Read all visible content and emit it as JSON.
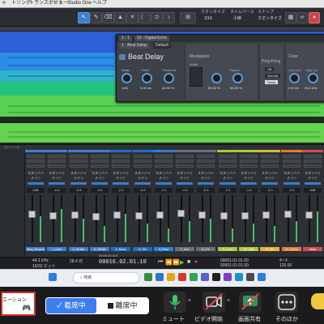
{
  "menubar": {
    "items": [
      "ャ",
      "ト",
      "ソング",
      "トランスポート",
      "ビュー",
      "Studio One",
      "ヘルプ"
    ]
  },
  "toolbar": {
    "tools": [
      "arrow",
      "pencil",
      "eraser",
      "paint",
      "mute",
      "split",
      "glue",
      "listen"
    ],
    "snap": "小節",
    "quantize": "1/16",
    "timebase": "タイムベース",
    "snap_label": "スナップ",
    "quantize_label": "クオンタイズ",
    "snap_value": "クオンタイズ"
  },
  "plugin": {
    "tabs": [
      "1 - 1",
      "12 - Digital Echo",
      "1 - Beat Delay"
    ],
    "title": "Beat Delay",
    "preset": "Default",
    "knobs": [
      {
        "label": "Beats",
        "value": "1/16"
      },
      {
        "label": "Offset",
        "value": "0.00 ms"
      },
      {
        "label": "Feedback",
        "value": "40.00 %"
      }
    ],
    "modulation": {
      "title": "Modulation",
      "items": [
        {
          "label": "Width",
          "value": "50.00 %"
        },
        {
          "label": "Speed",
          "value": "50.00 %"
        },
        {
          "label": "Stereo Spread",
          "value": "dB"
        }
      ]
    },
    "ping_pong": {
      "title": "Ping-Pong",
      "options": [
        "Off",
        "Normal",
        "Swap"
      ]
    },
    "color": {
      "title": "Color",
      "items": [
        {
          "label": "Low Cut",
          "value": "0.00 Hz"
        },
        {
          "label": "High Cut",
          "value": "20.0 kHz"
        }
      ]
    },
    "mix_label": "Mix"
  },
  "console": {
    "label": "コンソール",
    "channels": [
      {
        "name": "Bus_Drums",
        "stripe": "#3b7fd1",
        "volume": "0dB",
        "send": "スタンバイ",
        "mode": "メイン",
        "level": 0.55,
        "fader": 0.62
      },
      {
        "name": "1_Kick",
        "stripe": "#3b7fd1",
        "volume": "-0.6",
        "send": "スタンバイ",
        "mode": "メイン",
        "level": 0.7,
        "fader": 0.58
      },
      {
        "name": "2_Snare",
        "stripe": "#3b7fd1",
        "volume": "-0.5",
        "send": "スタンバイ",
        "mode": "メイン",
        "level": 0.5,
        "fader": 0.6
      },
      {
        "name": "3_HiHat",
        "stripe": "#3b7fd1",
        "volume": "-5.0",
        "send": "スタンバイ",
        "mode": "メイン",
        "level": 0.35,
        "fader": 0.56
      },
      {
        "name": "4_Bass",
        "stripe": "#1e6fc4",
        "volume": "-2.0",
        "send": "スタンバイ",
        "mode": "メイン",
        "level": 0.6,
        "fader": 0.6
      },
      {
        "name": "5_Gtr",
        "stripe": "#1e6fc4",
        "volume": "-3.0",
        "send": "スタンバイ",
        "mode": "メイン",
        "level": 0.4,
        "fader": 0.57
      },
      {
        "name": "6_Pad",
        "stripe": "#2a7fd8",
        "volume": "-1.2",
        "send": "スタンバイ",
        "mode": "メイン",
        "level": 0.3,
        "fader": 0.6
      },
      {
        "name": "7_Vox",
        "stripe": "#6a7079",
        "volume": "-4.5",
        "send": "スタンバイ",
        "mode": "メイン",
        "level": 0.45,
        "fader": 0.63
      },
      {
        "name": "8_FX",
        "stripe": "#6a7079",
        "volume": "-0.5",
        "send": "スタンバイ",
        "mode": "メイン",
        "level": 0.5,
        "fader": 0.6
      },
      {
        "name": "9_Lead",
        "stripe": "#a6c93a",
        "volume": "-2.1",
        "send": "スタンバイ",
        "mode": "メイン",
        "level": 0.3,
        "fader": 0.58
      },
      {
        "name": "10_Arp",
        "stripe": "#b6c93a",
        "volume": "-1.8",
        "send": "スタンバイ",
        "mode": "メイン",
        "level": 0.4,
        "fader": 0.57
      },
      {
        "name": "11_Str",
        "stripe": "#e0b537",
        "volume": "-3.3",
        "send": "スタンバイ",
        "mode": "メイン",
        "level": 0.35,
        "fader": 0.6
      },
      {
        "name": "12_Echo",
        "stripe": "#e57a35",
        "volume": "-2.0",
        "send": "スタンバイ",
        "mode": "メイン",
        "level": 0.45,
        "fader": 0.62
      },
      {
        "name": "Main",
        "stripe": "#d14d4d",
        "volume": "0dB",
        "send": "スタンバイ",
        "mode": "メイン",
        "level": 0.65,
        "fader": 0.6
      }
    ]
  },
  "transport": {
    "sample_rate": "44.1 kHz",
    "bits": "16/32 ビット",
    "record_max": "28.4 日",
    "position": "00016.02.01.10",
    "time": "00:00:34.513",
    "loop_start": "00001.01.01.00",
    "loop_end": "00001.01.01.00",
    "signature": "4 / 4",
    "tempo": "120.00"
  },
  "taskbar": {
    "search_placeholder": "検索"
  },
  "zoom": {
    "logo_text": "エーション",
    "attend_on": "着席中",
    "attend_off": "離席中",
    "buttons": [
      {
        "label": "ミュート",
        "icon": "microphone-icon"
      },
      {
        "label": "ビデオ開始",
        "icon": "video-off-icon"
      },
      {
        "label": "画面共有",
        "icon": "share-screen-icon"
      },
      {
        "label": "そのほか",
        "icon": "more-icon"
      }
    ]
  }
}
